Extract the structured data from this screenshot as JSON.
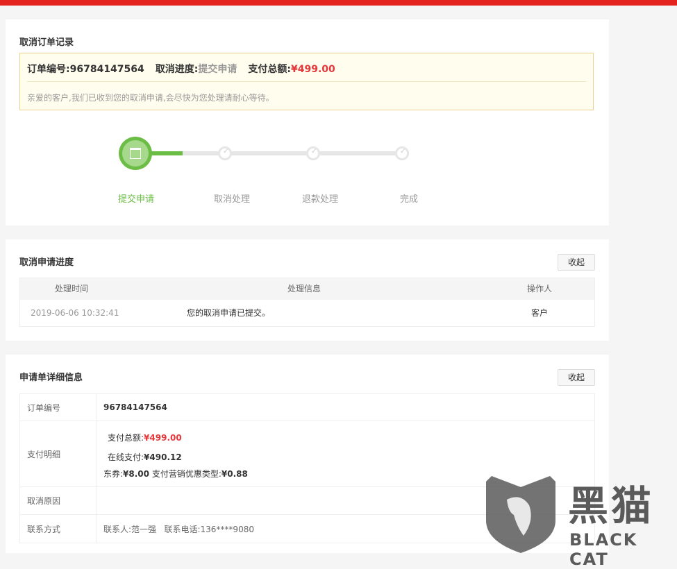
{
  "section1": {
    "title": "取消订单记录",
    "order_label": "订单编号:",
    "order_no": "96784147564",
    "progress_label": "取消进度:",
    "progress_status": "提交申请",
    "pay_label": "支付总额:",
    "pay_amount": "¥499.00",
    "message": "亲爱的客户,我们已收到您的取消申请,会尽快为您处理请耐心等待。",
    "steps": [
      "提交申请",
      "取消处理",
      "退款处理",
      "完成"
    ]
  },
  "section2": {
    "title": "取消申请进度",
    "collapse": "收起",
    "headers": [
      "处理时间",
      "处理信息",
      "操作人"
    ],
    "rows": [
      {
        "time": "2019-06-06 10:32:41",
        "info": "您的取消申请已提交。",
        "operator": "客户"
      }
    ]
  },
  "section3": {
    "title": "申请单详细信息",
    "collapse": "收起",
    "order_label": "订单编号",
    "order_no": "96784147564",
    "pay_label": "支付明细",
    "pay_total_label": "支付总额:",
    "pay_total": "¥499.00",
    "online_label": "在线支付:",
    "online_amount": "¥490.12",
    "coupon_label": "东券:",
    "coupon_amount": "¥8.00",
    "promo_label": "支付营销优惠类型:",
    "promo_amount": "¥0.88",
    "reason_label": "取消原因",
    "reason_value": "",
    "contact_label": "联系方式",
    "contact_value": "联系人:范一强   联系电话:136****9080"
  },
  "watermark": {
    "cn": "黑猫",
    "en": "BLACK CAT"
  },
  "colors": {
    "accent_red": "#e4231e",
    "price_red": "#e4393c",
    "progress_green": "#6cbd45"
  }
}
